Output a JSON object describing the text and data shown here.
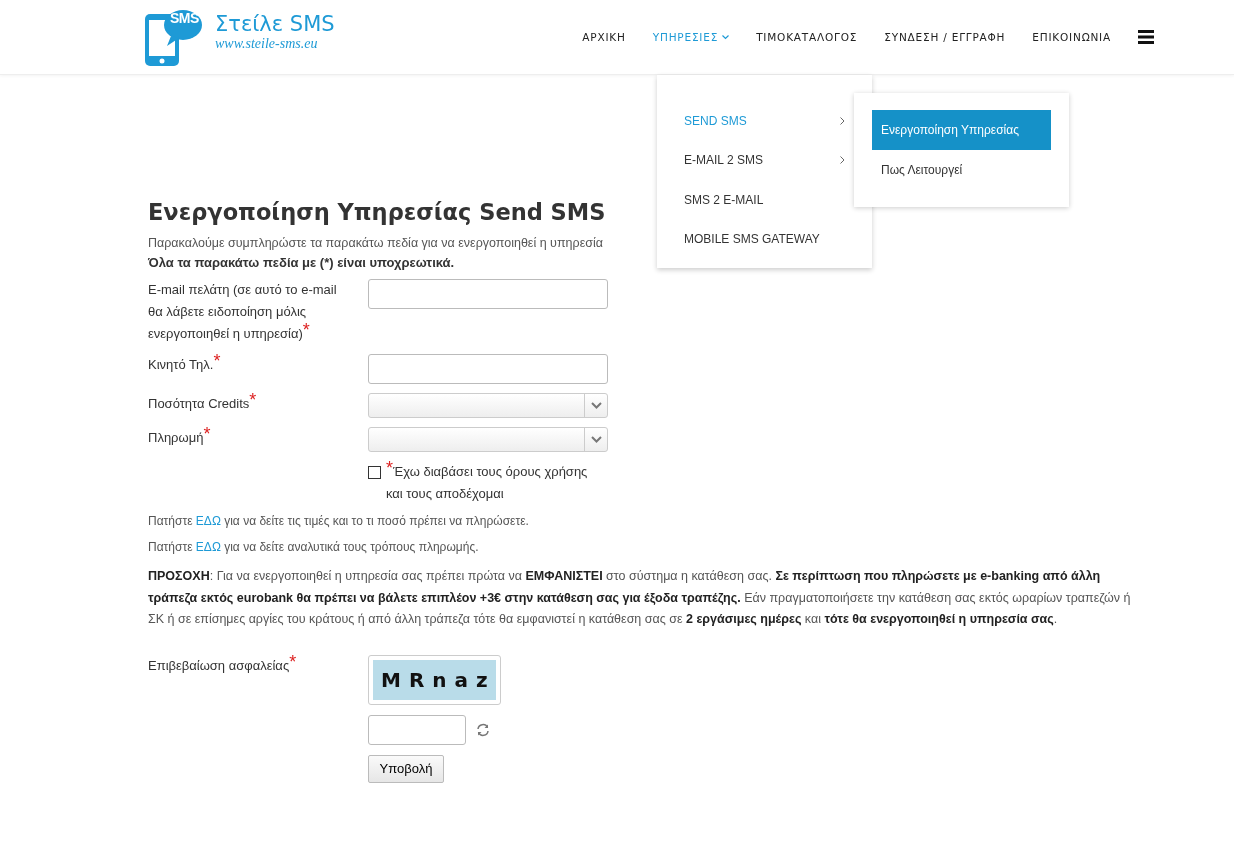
{
  "logo": {
    "badge": "SMS",
    "title": "Στείλε SMS",
    "url": "www.steile-sms.eu"
  },
  "nav": [
    {
      "label": "ΑΡΧΙΚΗ",
      "selected": false,
      "has_caret": false
    },
    {
      "label": "ΥΠΗΡΕΣΙΕΣ",
      "selected": true,
      "has_caret": true
    },
    {
      "label": "ΤΙΜΟΚΑΤΑΛΟΓΟΣ",
      "selected": false,
      "has_caret": false
    },
    {
      "label": "ΣΥΝΔΕΣΗ / ΕΓΓΡΑΦΗ",
      "selected": false,
      "has_caret": false
    },
    {
      "label": "ΕΠΙΚΟΙΝΩΝΙΑ",
      "selected": false,
      "has_caret": false
    }
  ],
  "dropdown": [
    {
      "label": "SEND SMS",
      "selected": true,
      "has_submenu": true
    },
    {
      "label": "E-MAIL 2 SMS",
      "selected": false,
      "has_submenu": true
    },
    {
      "label": "SMS 2 E-MAIL",
      "selected": false,
      "has_submenu": false
    },
    {
      "label": "MOBILE SMS GATEWAY",
      "selected": false,
      "has_submenu": false
    }
  ],
  "submenu": [
    {
      "label": "Ενεργοποίηση Υπηρεσίας",
      "selected": true
    },
    {
      "label": "Πως Λειτουργεί",
      "selected": false
    }
  ],
  "heading": "Ενεργοποίηση Υπηρεσίας Send SMS",
  "intro": "Παρακαλούμε συμπληρώστε τα παρακάτω πεδία για να ενεργοποιηθεί η υπηρεσία",
  "required_note": "Όλα τα παρακάτω πεδία με (*) είναι υποχρεωτικά.",
  "fields": [
    {
      "kind": "text",
      "label": "E-mail πελάτη (σε αυτό το e-mail θα λάβετε ειδοποίηση μόλις ενεργοποιηθεί η υπηρεσία)",
      "asterisk": "*"
    },
    {
      "kind": "text",
      "label": "Κινητό Τηλ.",
      "asterisk": "*"
    },
    {
      "kind": "select",
      "label": "Ποσότητα Credits",
      "asterisk": "*"
    },
    {
      "kind": "select",
      "label": "Πληρωμή",
      "asterisk": "*"
    }
  ],
  "terms": {
    "checked": false,
    "asterisk": "*",
    "label": "Έχω διαβάσει τους όρους χρήσης και τους αποδέχομαι"
  },
  "link_lines": [
    {
      "before": "Πατήστε",
      "link": "ΕΔΩ",
      "after": "για να δείτε τις τιμές και το τι ποσό πρέπει να πληρώσετε."
    },
    {
      "before": "Πατήστε",
      "link": "ΕΔΩ",
      "after": "για να δείτε αναλυτικά τους τρόπους πληρωμής."
    }
  ],
  "notice": "**ΠΡΟΣΟΧΗ**: Για να ενεργοποιηθεί η υπηρεσία σας πρέπει πρώτα να **ΕΜΦΑΝΙΣΤΕΙ** στο σύστημα η κατάθεση σας. **Σε περίπτωση που πληρώσετε με e-banking από άλλη τράπεζα εκτός eurobank θα πρέπει να βάλετε επιπλέον +3€ στην κατάθεση σας για έξοδα τραπέζης.** Εάν πραγματοποιήσετε την κατάθεση σας εκτός ωραρίων τραπεζών ή ΣΚ ή σε επίσημες αργίες του κράτους ή από άλλη τράπεζα τότε θα εμφανιστεί η κατάθεση σας σε **2 εργάσιμες ημέρες** και **τότε θα ενεργοποιηθεί η υπηρεσία σας**.",
  "captcha": {
    "label": "Επιβεβαίωση ασφαλείας",
    "asterisk": "*",
    "code": "MRnaz"
  },
  "submit": "Υποβολή"
}
